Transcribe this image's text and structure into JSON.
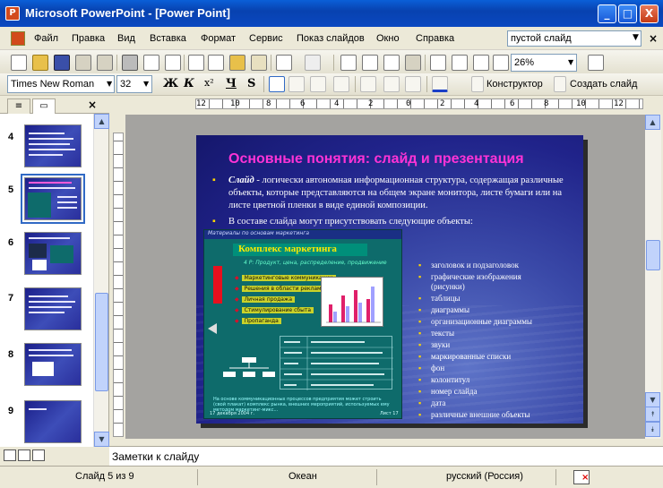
{
  "window": {
    "title": "Microsoft PowerPoint - [Power Point]",
    "min": "_",
    "max": "□",
    "close": "X"
  },
  "menu": {
    "items": [
      "Файл",
      "Правка",
      "Вид",
      "Вставка",
      "Формат",
      "Сервис",
      "Показ слайдов",
      "Окно",
      "Справка"
    ],
    "ask_value": "пустой слайд"
  },
  "formatting": {
    "font": "Times New Roman",
    "size": "32",
    "bold": "Ж",
    "italic": "К",
    "superscript": "x²",
    "underline": "Ч",
    "shadow": "S",
    "design_label": "Конструктор",
    "new_slide_label": "Создать слайд",
    "zoom": "26%"
  },
  "ruler": {
    "marks": [
      "12",
      "10",
      "8",
      "6",
      "4",
      "2",
      "0",
      "2",
      "4",
      "6",
      "8",
      "10",
      "12"
    ]
  },
  "slides_panel": {
    "numbers": [
      "4",
      "5",
      "6",
      "7",
      "8",
      "9"
    ],
    "selected_index": 1
  },
  "slide": {
    "title": "Основные понятия: слайд и презентация",
    "para1_keyword": "Слайд",
    "para1_text": " - логически автономная информационная структура, содержащая различные объекты, которые представляются на общем экране монитора, листе бумаги или на листе цветной пленки в виде единой композиции.",
    "para2": "В составе слайда могут присутствовать следующие объекты:",
    "embedded": {
      "header": "Материалы по основам маркетинга",
      "title": "Комплекс маркетинга",
      "subtitle": "4 Р: Продукт, цена, распределение, продвижение",
      "items": [
        "Маркетинговые коммуникации",
        "Решения в области рекламы",
        "Личная продажа",
        "Стимулирование сбыта",
        "Пропаганда"
      ],
      "footer": "На основе коммуникационных процессов предприятия может строить (свой плакат) комплекс рынка, внешних мероприятий, используемых ему методом маркетинг-микс...",
      "date": "17 декабря 2004 г.",
      "page": "Лист 17"
    },
    "objects": [
      "заголовок и подзаголовок",
      "графические изображения (рисунки)",
      "таблицы",
      "диаграммы",
      "организационные диаграммы",
      "тексты",
      "звуки",
      "маркированные списки",
      "фон",
      "колонтитул",
      "номер слайда",
      "дата",
      "различные внешние объекты"
    ]
  },
  "notes": {
    "placeholder": "Заметки к слайду"
  },
  "status": {
    "slide_info": "Слайд 5 из 9",
    "design": "Океан",
    "language": "русский (Россия)"
  }
}
